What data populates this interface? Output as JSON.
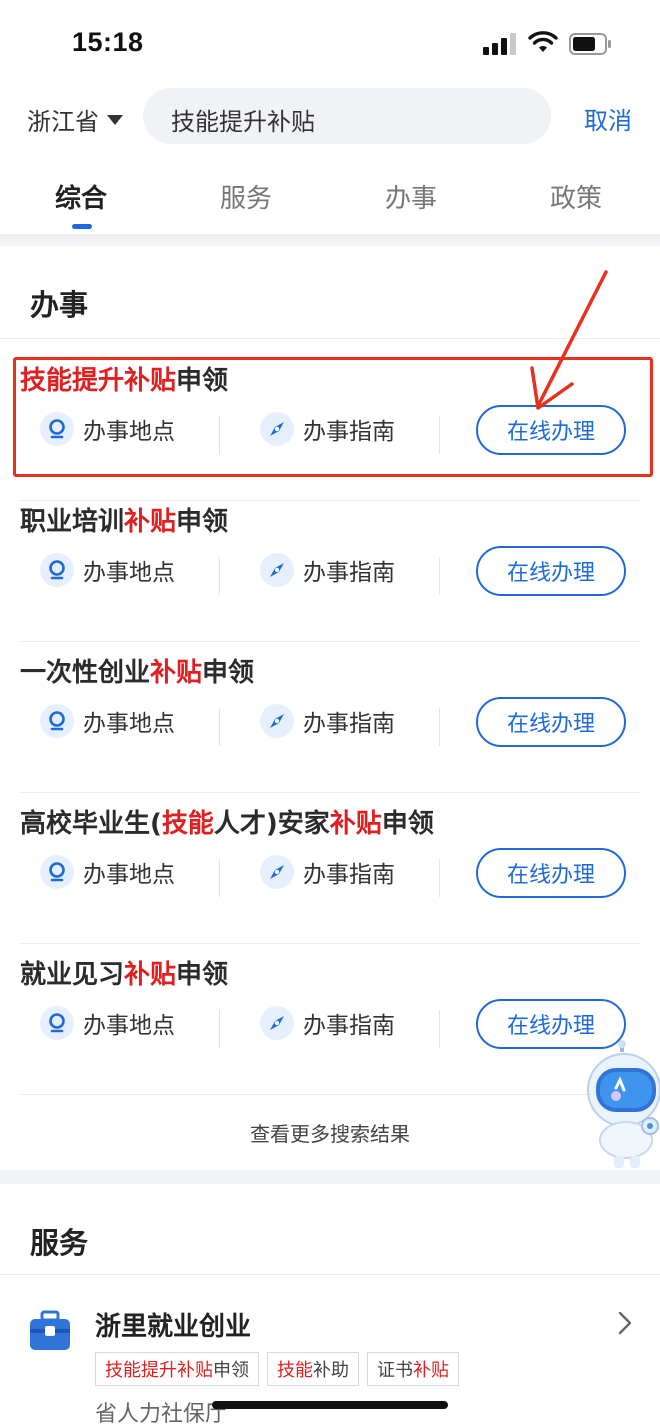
{
  "status_bar": {
    "time": "15:18"
  },
  "search": {
    "province": "浙江省",
    "query": "技能提升补贴",
    "cancel": "取消"
  },
  "tabs": [
    {
      "label": "综合",
      "active": true
    },
    {
      "label": "服务",
      "active": false
    },
    {
      "label": "办事",
      "active": false
    },
    {
      "label": "政策",
      "active": false
    }
  ],
  "banshi": {
    "title": "办事",
    "items": [
      {
        "segments": [
          [
            "技能提升补贴",
            true
          ],
          [
            "申领",
            false
          ]
        ],
        "highlighted_box": true
      },
      {
        "segments": [
          [
            "职业培训",
            false
          ],
          [
            "补贴",
            true
          ],
          [
            "申领",
            false
          ]
        ]
      },
      {
        "segments": [
          [
            "一次性创业",
            false
          ],
          [
            "补贴",
            true
          ],
          [
            "申领",
            false
          ]
        ]
      },
      {
        "segments": [
          [
            "高校毕业生(",
            false
          ],
          [
            "技能",
            true
          ],
          [
            "人才)安家",
            false
          ],
          [
            "补贴",
            true
          ],
          [
            "申领",
            false
          ]
        ]
      },
      {
        "segments": [
          [
            "就业见习",
            false
          ],
          [
            "补贴",
            true
          ],
          [
            "申领",
            false
          ]
        ]
      }
    ],
    "action_location": "办事地点",
    "action_guide": "办事指南",
    "action_online": "在线办理",
    "more": "查看更多搜索结果"
  },
  "service": {
    "title": "服务",
    "name": "浙里就业创业",
    "tags": [
      [
        [
          "技能提升补贴",
          true
        ],
        [
          "申领",
          false
        ]
      ],
      [
        [
          "技能",
          true
        ],
        [
          "补助",
          false
        ]
      ],
      [
        [
          "证书",
          false
        ],
        [
          "补贴",
          true
        ]
      ]
    ],
    "org": "省人力社保厅",
    "icon": "briefcase-icon"
  },
  "colors": {
    "accent": "#1e6ad8",
    "highlight": "#e02020",
    "annotation": "#e8301c"
  }
}
